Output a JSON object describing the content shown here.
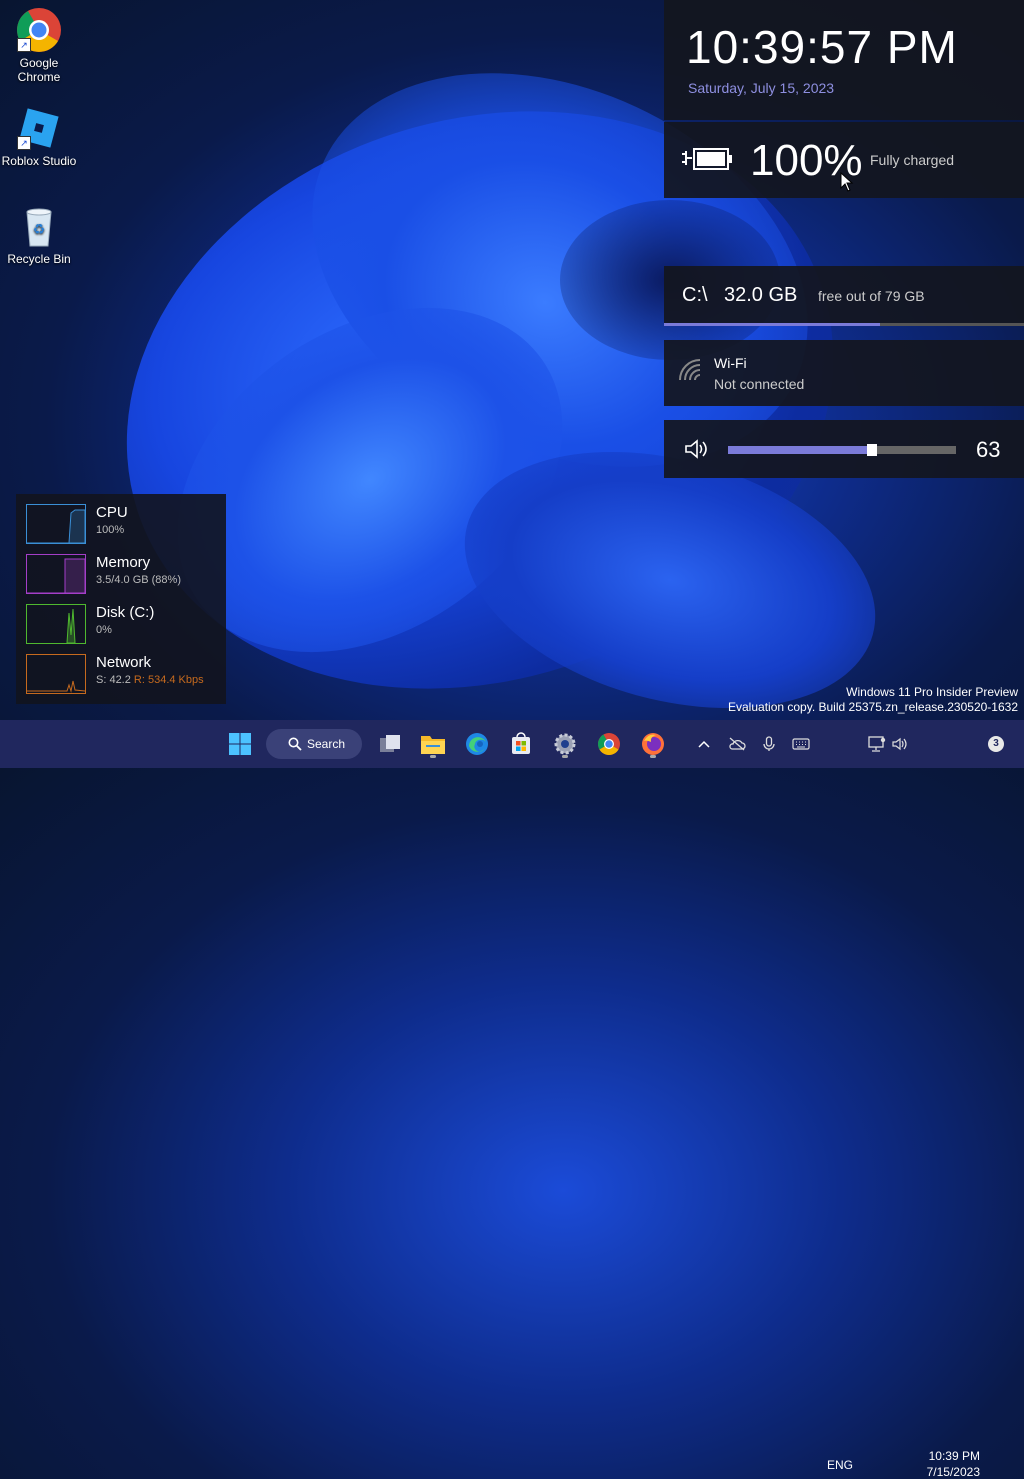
{
  "desktop": {
    "icons": [
      {
        "label_line1": "Google",
        "label_line2": "Chrome",
        "icon": "chrome-icon"
      },
      {
        "label_line1": "Roblox Studio",
        "icon": "roblox-studio-icon"
      },
      {
        "label_line1": "Recycle Bin",
        "icon": "recycle-bin-icon"
      }
    ]
  },
  "clock": {
    "time": "10:39:57 PM",
    "date": "Saturday, July 15, 2023"
  },
  "battery": {
    "percent": "100%",
    "status": "Fully charged",
    "icon": "battery-charging-icon"
  },
  "disk": {
    "drive": "C:\\",
    "free": "32.0 GB",
    "of": "free out of 79 GB",
    "used_fraction": 0.6
  },
  "wifi": {
    "name": "Wi-Fi",
    "status": "Not connected",
    "icon": "wifi-icon"
  },
  "volume": {
    "level": 63,
    "level_label": "63",
    "icon": "speaker-icon"
  },
  "resources": [
    {
      "label": "CPU",
      "value": "100%",
      "color": "#3a8fd6"
    },
    {
      "label": "Memory",
      "value": "3.5/4.0 GB (88%)",
      "color": "#a43ec8"
    },
    {
      "label": "Disk (C:)",
      "value": "0%",
      "color": "#4fb82f"
    },
    {
      "label": "Network",
      "value_s": "S: 42.2",
      "value_r": "R: 534.4 Kbps",
      "color": "#c66a1e"
    }
  ],
  "watermark": {
    "line1": "Windows 11 Pro Insider Preview",
    "line2": "Evaluation copy. Build 25375.zn_release.230520-1632"
  },
  "taskbar": {
    "search_label": "Search",
    "language": "ENG",
    "time": "10:39 PM",
    "date": "7/15/2023",
    "notification_count": "3"
  },
  "colors": {
    "accent": "#7b7bd9",
    "taskbar": "#20275e",
    "date_text": "#8e8fe0"
  }
}
